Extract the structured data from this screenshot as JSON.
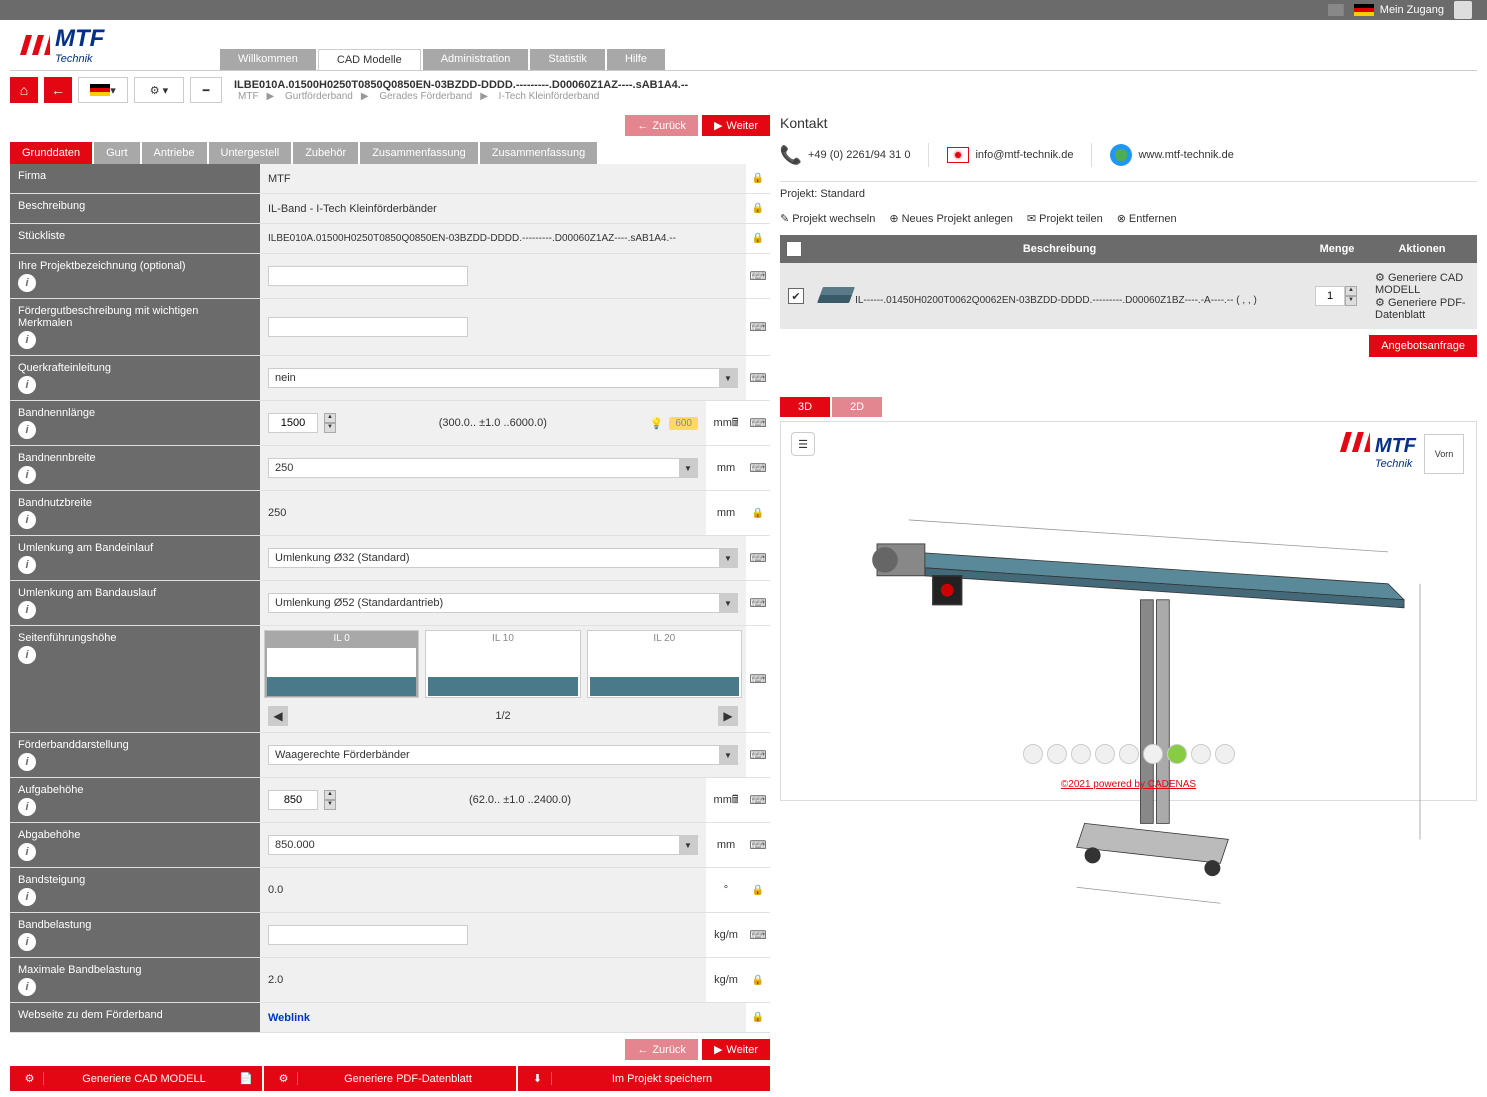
{
  "topBar": {
    "meinZugang": "Mein Zugang"
  },
  "nav": {
    "tabs": [
      "Willkommen",
      "CAD Modelle",
      "Administration",
      "Statistik",
      "Hilfe"
    ],
    "activeIndex": 1
  },
  "breadcrumb": {
    "title": "ILBE010A.01500H0250T0850Q0850EN-03BZDD-DDDD.---------.D00060Z1AZ----.sAB1A4.--",
    "path": [
      "MTF",
      "Gurtförderband",
      "Gerades Förderband",
      "I-Tech Kleinförderband"
    ]
  },
  "navBtns": {
    "back": "Zurück",
    "next": "Weiter"
  },
  "subTabs": [
    "Grunddaten",
    "Gurt",
    "Antriebe",
    "Untergestell",
    "Zubehör",
    "Zusammenfassung",
    "Zusammenfassung"
  ],
  "form": {
    "firma": {
      "label": "Firma",
      "value": "MTF"
    },
    "beschreibung": {
      "label": "Beschreibung",
      "value": "IL-Band - I-Tech Kleinförderbänder"
    },
    "stueckliste": {
      "label": "Stückliste",
      "value": "ILBE010A.01500H0250T0850Q0850EN-03BZDD-DDDD.---------.D00060Z1AZ----.sAB1A4.--"
    },
    "projektbez": {
      "label": "Ihre Projektbezeichnung (optional)",
      "value": ""
    },
    "foerdergut": {
      "label": "Fördergutbeschreibung mit wichtigen Merkmalen",
      "value": ""
    },
    "querkraft": {
      "label": "Querkrafteinleitung",
      "value": "nein"
    },
    "bandlaenge": {
      "label": "Bandnennlänge",
      "value": "1500",
      "range": "(300.0.. ±1.0 ..6000.0)",
      "hint": "600",
      "unit": "mm"
    },
    "bandbreite": {
      "label": "Bandnennbreite",
      "value": "250",
      "unit": "mm"
    },
    "bandnutz": {
      "label": "Bandnutzbreite",
      "value": "250",
      "unit": "mm"
    },
    "umlenkEin": {
      "label": "Umlenkung am Bandeinlauf",
      "value": "Umlenkung Ø32 (Standard)"
    },
    "umlenkAus": {
      "label": "Umlenkung am Bandauslauf",
      "value": "Umlenkung Ø52 (Standardantrieb)"
    },
    "seitenf": {
      "label": "Seitenführungshöhe",
      "options": [
        "IL 0",
        "IL 10",
        "IL 20"
      ],
      "page": "1/2"
    },
    "foerderdar": {
      "label": "Förderbanddarstellung",
      "value": "Waagerechte Förderbänder"
    },
    "aufgabe": {
      "label": "Aufgabehöhe",
      "value": "850",
      "range": "(62.0.. ±1.0 ..2400.0)",
      "unit": "mm"
    },
    "abgabe": {
      "label": "Abgabehöhe",
      "value": "850.000",
      "unit": "mm"
    },
    "bandsteigung": {
      "label": "Bandsteigung",
      "value": "0.0",
      "unit": "°"
    },
    "bandbelastung": {
      "label": "Bandbelastung",
      "value": "",
      "unit": "kg/m"
    },
    "maxbelastung": {
      "label": "Maximale Bandbelastung",
      "value": "2.0",
      "unit": "kg/m"
    },
    "webseite": {
      "label": "Webseite zu dem Förderband",
      "value": "Weblink"
    }
  },
  "actionBtns": {
    "cad": "Generiere CAD MODELL",
    "pdf": "Generiere PDF-Datenblatt",
    "save": "Im Projekt speichern"
  },
  "kontakt": {
    "title": "Kontakt",
    "phone": "+49 (0) 2261/94 31 0",
    "email": "info@mtf-technik.de",
    "web": "www.mtf-technik.de"
  },
  "projekt": {
    "label": "Projekt:",
    "name": "Standard",
    "actions": {
      "wechseln": "Projekt wechseln",
      "neues": "Neues Projekt anlegen",
      "teilen": "Projekt teilen",
      "entfernen": "Entfernen"
    },
    "headers": {
      "beschreibung": "Beschreibung",
      "menge": "Menge",
      "aktionen": "Aktionen"
    },
    "row": {
      "desc": "IL------.01450H0200T0062Q0062EN-03BZDD-DDDD.---------.D00060Z1BZ----.-A----.-- ( , , )",
      "menge": "1",
      "aktionCad": "Generiere CAD MODELL",
      "aktionPdf": "Generiere PDF-Datenblatt"
    },
    "angebot": "Angebotsanfrage"
  },
  "view": {
    "tabs": [
      "3D",
      "2D"
    ],
    "cubeLabel": "Vorn",
    "footer": "©2021 powered by CADENAS"
  }
}
